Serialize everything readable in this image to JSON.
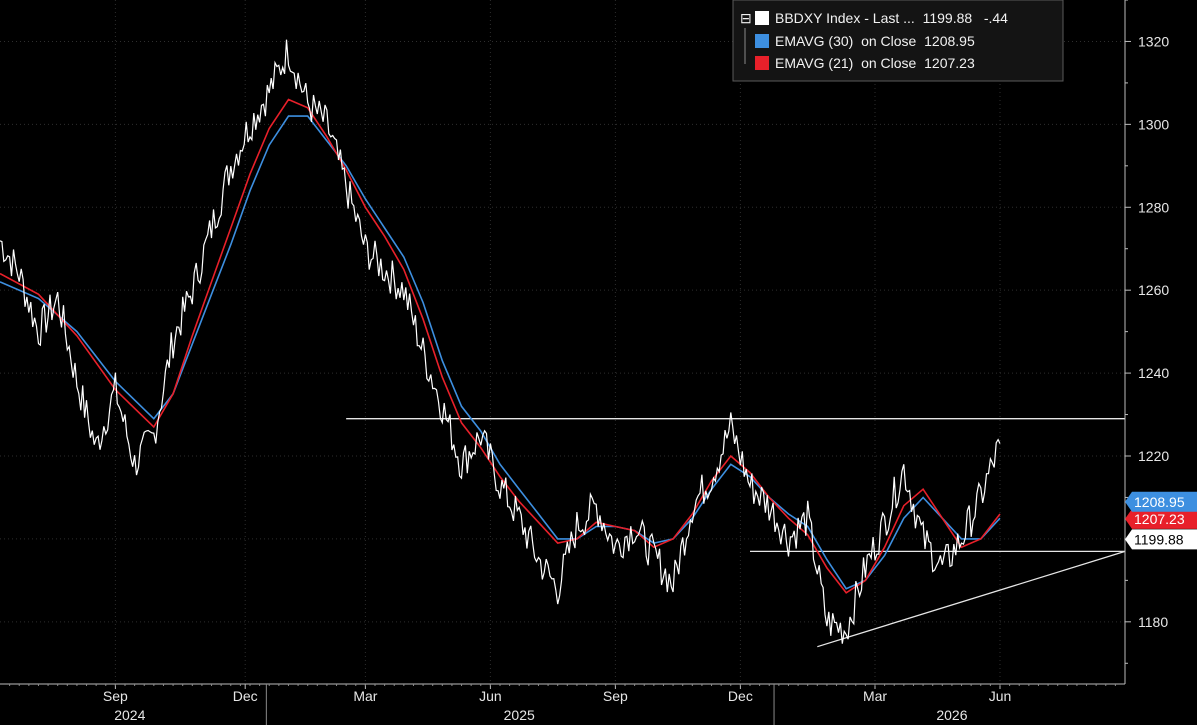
{
  "chart_data": {
    "type": "line",
    "title": "",
    "xlabel": "",
    "ylabel": "",
    "ylim": [
      1165,
      1330
    ],
    "y_ticks": [
      1180,
      1200,
      1220,
      1240,
      1260,
      1280,
      1300,
      1320
    ],
    "y_tick_labels": [
      "1180",
      "1200",
      "1220",
      "1240",
      "1260",
      "1280",
      "1300",
      "1320"
    ],
    "x_month_labels": [
      "Sep",
      "Dec",
      "Mar",
      "Jun",
      "Sep",
      "Dec",
      "Mar",
      "Jun"
    ],
    "x_year_labels": [
      "2024",
      "2025",
      "2026"
    ],
    "grid": true,
    "legend_position": "top-right",
    "legend": [
      {
        "key": "price",
        "text": "BBDXY Index - Last ...  1199.88   -.44",
        "color": "#ffffff"
      },
      {
        "key": "ema30",
        "text": "EMAVG (30)  on Close  1208.95",
        "color": "#3d8fe0"
      },
      {
        "key": "ema21",
        "text": "EMAVG (21)  on Close  1207.23",
        "color": "#e8202a"
      }
    ],
    "last_value_tags": [
      {
        "series": "ema30",
        "text": "1208.95",
        "value": 1208.95
      },
      {
        "series": "ema21",
        "text": "1207.23",
        "value": 1207.23
      },
      {
        "series": "price",
        "text": "1199.88",
        "value": 1199.88
      }
    ],
    "series": [
      {
        "key": "price",
        "x": [
          0,
          2,
          4,
          6,
          8,
          10,
          12,
          14,
          16,
          18,
          20,
          22,
          24,
          26,
          28,
          30,
          32,
          34,
          36,
          38,
          40,
          42,
          44,
          46,
          48,
          50,
          52,
          54,
          56,
          58,
          60,
          62,
          64,
          66,
          68,
          70,
          72,
          74,
          76,
          78,
          80,
          82,
          84,
          86,
          88,
          90,
          92,
          94,
          96,
          98,
          100,
          102,
          104
        ],
        "values": [
          1272,
          1264,
          1250,
          1258,
          1238,
          1222,
          1236,
          1218,
          1225,
          1248,
          1260,
          1275,
          1290,
          1300,
          1308,
          1318,
          1305,
          1300,
          1285,
          1270,
          1265,
          1260,
          1245,
          1232,
          1218,
          1225,
          1213,
          1205,
          1195,
          1188,
          1203,
          1208,
          1198,
          1203,
          1196,
          1189,
          1208,
          1215,
          1227,
          1213,
          1208,
          1200,
          1205,
          1180,
          1178,
          1193,
          1204,
          1217,
          1200,
          1193,
          1200,
          1210,
          1223
        ],
        "color": "#ffffff"
      },
      {
        "key": "ema30",
        "x": [
          0,
          4,
          8,
          12,
          16,
          18,
          20,
          22,
          24,
          26,
          28,
          30,
          32,
          34,
          36,
          38,
          40,
          42,
          44,
          46,
          48,
          50,
          52,
          54,
          56,
          58,
          60,
          62,
          64,
          66,
          68,
          70,
          72,
          74,
          76,
          78,
          80,
          82,
          84,
          86,
          88,
          90,
          92,
          94,
          96,
          98,
          100,
          102,
          104
        ],
        "values": [
          1262,
          1258,
          1250,
          1238,
          1229,
          1235,
          1247,
          1259,
          1271,
          1284,
          1295,
          1302,
          1302,
          1296,
          1290,
          1282,
          1275,
          1268,
          1257,
          1243,
          1232,
          1226,
          1218,
          1212,
          1206,
          1200,
          1200,
          1203,
          1203,
          1202,
          1199,
          1200,
          1205,
          1212,
          1218,
          1215,
          1210,
          1206,
          1203,
          1195,
          1188,
          1190,
          1196,
          1205,
          1210,
          1205,
          1200,
          1200,
          1205
        ],
        "color": "#3d8fe0"
      },
      {
        "key": "ema21",
        "x": [
          0,
          4,
          8,
          12,
          16,
          18,
          20,
          22,
          24,
          26,
          28,
          30,
          32,
          34,
          36,
          38,
          40,
          42,
          44,
          46,
          48,
          50,
          52,
          54,
          56,
          58,
          60,
          62,
          64,
          66,
          68,
          70,
          72,
          74,
          76,
          78,
          80,
          82,
          84,
          86,
          88,
          90,
          92,
          94,
          96,
          98,
          100,
          102,
          104
        ],
        "values": [
          1264,
          1259,
          1249,
          1236,
          1227,
          1235,
          1249,
          1262,
          1275,
          1288,
          1299,
          1306,
          1304,
          1297,
          1289,
          1280,
          1273,
          1265,
          1253,
          1239,
          1228,
          1222,
          1215,
          1209,
          1204,
          1199,
          1200,
          1204,
          1203,
          1202,
          1198,
          1200,
          1206,
          1214,
          1220,
          1216,
          1210,
          1205,
          1201,
          1193,
          1187,
          1190,
          1198,
          1208,
          1212,
          1205,
          1198,
          1200,
          1206
        ],
        "color": "#e8202a"
      }
    ],
    "annotations": [
      {
        "kind": "hline",
        "y": 1229,
        "x_from": 36
      },
      {
        "kind": "hline",
        "y": 1197,
        "x_from": 78
      },
      {
        "kind": "trendline",
        "from": [
          85,
          1174
        ],
        "to": [
          117,
          1197
        ]
      }
    ]
  }
}
